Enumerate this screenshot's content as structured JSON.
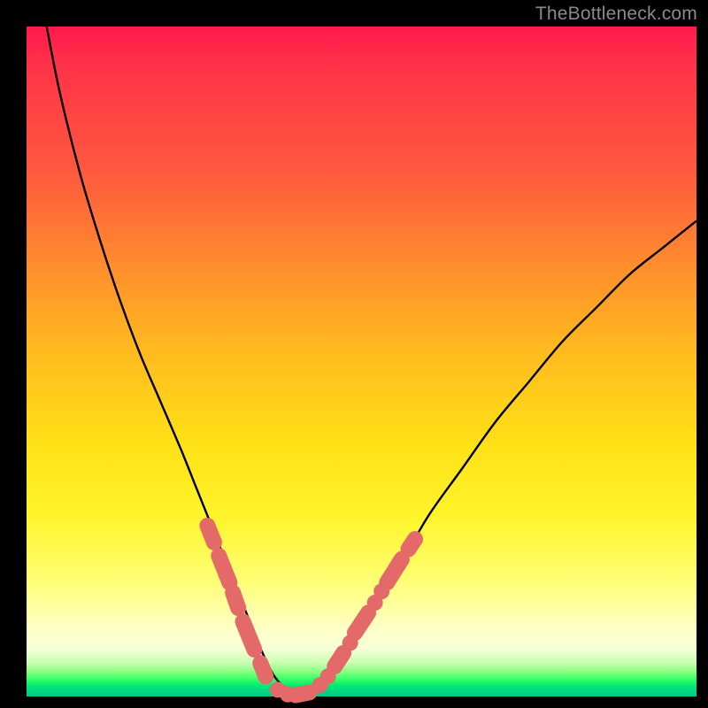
{
  "watermark": "TheBottleneck.com",
  "colors": {
    "frame": "#000000",
    "curve": "#000000",
    "marker_fill": "#e46a6a",
    "marker_stroke": "#d25a5a"
  },
  "chart_data": {
    "type": "line",
    "title": "",
    "xlabel": "",
    "ylabel": "",
    "xlim": [
      0,
      100
    ],
    "ylim": [
      0,
      100
    ],
    "grid": false,
    "legend": false,
    "series": [
      {
        "name": "bottleneck-curve",
        "x": [
          3,
          5,
          8,
          11,
          14,
          17,
          20,
          23,
          25,
          27,
          29,
          31,
          33,
          35,
          37,
          39,
          41,
          44,
          48,
          52,
          56,
          60,
          65,
          70,
          75,
          80,
          85,
          90,
          95,
          100
        ],
        "y": [
          100,
          90,
          78,
          68,
          59,
          51,
          44,
          37,
          32,
          27,
          22,
          17,
          12,
          7,
          3,
          1,
          0,
          2,
          7,
          13,
          20,
          27,
          34,
          41,
          47,
          53,
          58,
          63,
          67,
          71
        ]
      }
    ],
    "markers": [
      {
        "kind": "capsule",
        "x1": 27.0,
        "y1": 25.5,
        "x2": 28.0,
        "y2": 23.0
      },
      {
        "kind": "capsule",
        "x1": 28.7,
        "y1": 21.0,
        "x2": 30.3,
        "y2": 17.0
      },
      {
        "kind": "capsule",
        "x1": 30.8,
        "y1": 15.5,
        "x2": 31.6,
        "y2": 13.2
      },
      {
        "kind": "capsule",
        "x1": 32.3,
        "y1": 11.2,
        "x2": 34.0,
        "y2": 7.0
      },
      {
        "kind": "capsule",
        "x1": 34.9,
        "y1": 5.0,
        "x2": 35.7,
        "y2": 3.0
      },
      {
        "kind": "dot",
        "x": 37.5,
        "y": 1.0
      },
      {
        "kind": "dot",
        "x": 39.0,
        "y": 0.3
      },
      {
        "kind": "capsule",
        "x1": 40.2,
        "y1": 0.2,
        "x2": 42.2,
        "y2": 0.6
      },
      {
        "kind": "dot",
        "x": 43.8,
        "y": 1.7
      },
      {
        "kind": "dot",
        "x": 45.0,
        "y": 3.0
      },
      {
        "kind": "capsule",
        "x1": 46.0,
        "y1": 4.5,
        "x2": 47.3,
        "y2": 6.5
      },
      {
        "kind": "dot",
        "x": 48.3,
        "y": 8.0
      },
      {
        "kind": "capsule",
        "x1": 49.0,
        "y1": 9.5,
        "x2": 51.0,
        "y2": 12.5
      },
      {
        "kind": "dot",
        "x": 52.0,
        "y": 14.0
      },
      {
        "kind": "dot",
        "x": 53.0,
        "y": 15.7
      },
      {
        "kind": "capsule",
        "x1": 53.8,
        "y1": 17.0,
        "x2": 56.0,
        "y2": 20.5
      },
      {
        "kind": "capsule",
        "x1": 57.0,
        "y1": 22.0,
        "x2": 58.0,
        "y2": 23.5
      }
    ]
  }
}
